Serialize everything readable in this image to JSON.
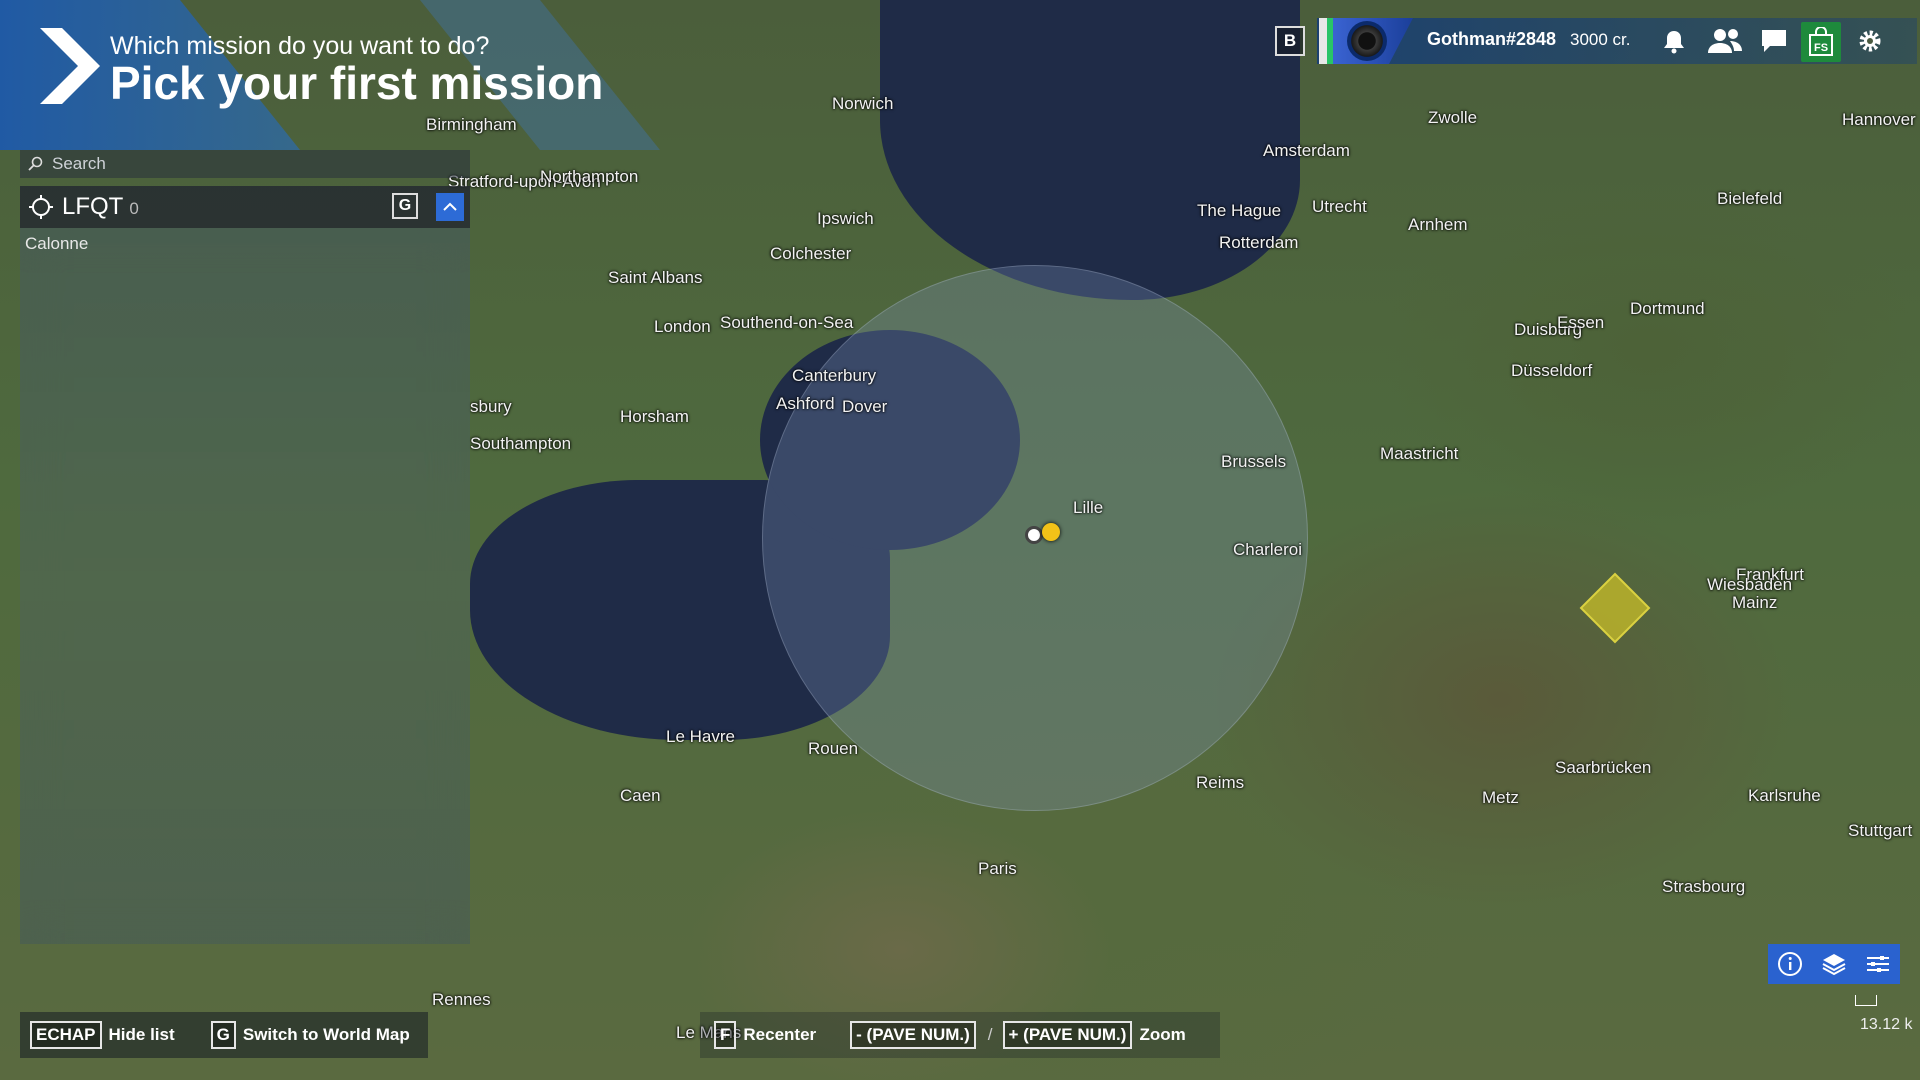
{
  "header": {
    "subtitle": "Which mission do you want to do?",
    "title": "Pick your first mission"
  },
  "search": {
    "placeholder": "Search"
  },
  "airport": {
    "code": "LFQT",
    "count": "0",
    "g_key": "G",
    "list_item": "Calonne"
  },
  "user": {
    "b_key": "B",
    "name": "Gothman#2848",
    "credits": "3000 cr."
  },
  "topbar_icons": [
    "bell-icon",
    "friends-icon",
    "chat-icon",
    "marketplace-icon",
    "settings-icon"
  ],
  "map_tools": [
    "info-icon",
    "layers-icon",
    "filters-icon"
  ],
  "scale": "13.12 k",
  "hints": {
    "hide_key": "ECHAP",
    "hide_label": "Hide list",
    "world_key": "G",
    "world_label": "Switch to World Map",
    "recenter_key": "F",
    "recenter_label": "Recenter",
    "zoom_out_key": "- (PAVE NUM.)",
    "zoom_sep": "/",
    "zoom_in_key": "+ (PAVE NUM.)",
    "zoom_label": "Zoom"
  },
  "cities": [
    "Norwich",
    "Birmingham",
    "Stratford-upon-Avon",
    "Northampton",
    "Ipswich",
    "Colchester",
    "Saint Albans",
    "London",
    "Southend-on-Sea",
    "Canterbury",
    "Ashford",
    "Dover",
    "Horsham",
    "sbury",
    "Southampton",
    "Zwolle",
    "Amsterdam",
    "The Hague",
    "Utrecht",
    "Arnhem",
    "Rotterdam",
    "Hannover",
    "Bielefeld",
    "Dortmund",
    "Duisburg",
    "Essen",
    "Düsseldorf",
    "Brussels",
    "Maastricht",
    "Lille",
    "Charleroi",
    "Frankfurt",
    "Wiesbaden",
    "Mainz",
    "Le Havre",
    "Rouen",
    "Caen",
    "Reims",
    "Saarbrücken",
    "Metz",
    "Karlsruhe",
    "Stuttgart",
    "Paris",
    "Strasbourg",
    "Rennes",
    "Le Mans"
  ],
  "colors": {
    "accent": "#2d6bd6",
    "marketplace": "#1e8a3c",
    "pin": "#f2c218",
    "sea": "#1f2b47"
  }
}
